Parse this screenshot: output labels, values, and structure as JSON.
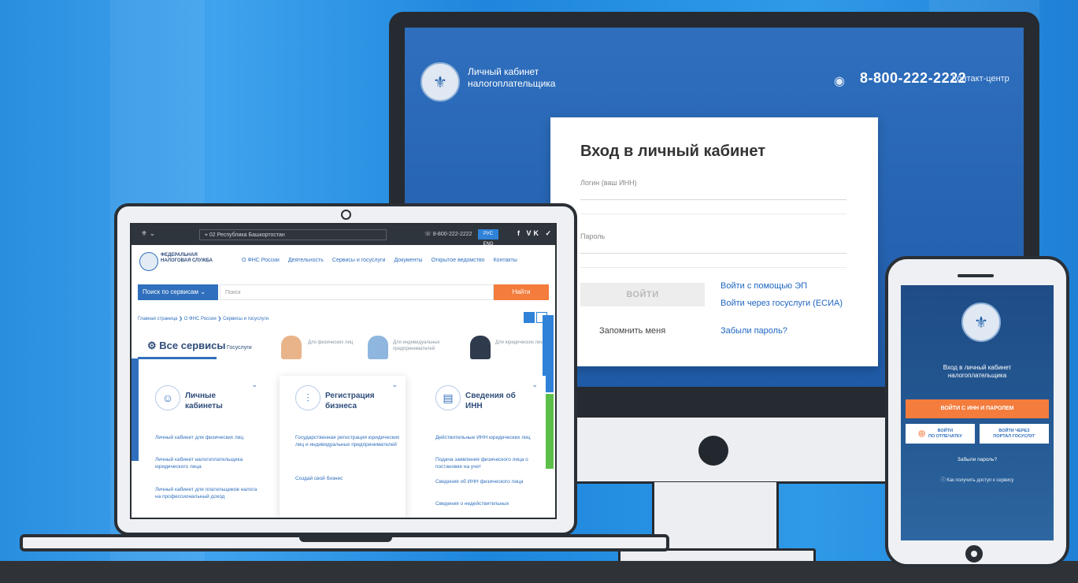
{
  "monitor": {
    "brand_line1": "Личный кабинет",
    "brand_line2": "налогоплательщика",
    "phone": "8-800-222-2222",
    "contact_center": "Контакт-центр",
    "login": {
      "title": "Вход в личный кабинет",
      "login_label": "Логин (ваш ИНН)",
      "password_label": "Пароль",
      "submit": "ВОЙТИ",
      "remember": "Запомнить меня",
      "ep_link": "Войти с помощью ЭП",
      "gos_link": "Войти через госуслуги (ЕСИА)",
      "forgot_link": "Забыли пароль?"
    }
  },
  "laptop": {
    "region": "02 Республика Башкортостан",
    "phone": "8-800-222-2222",
    "lang": "РУС ENG",
    "social": "f  VK  ✓",
    "org_line1": "ФЕДЕРАЛЬНАЯ",
    "org_line2": "НАЛОГОВАЯ СЛУЖБА",
    "nav": [
      "О ФНС России",
      "Деятельность",
      "Сервисы и госуслуги",
      "Документы",
      "Открытое ведомство",
      "Контакты"
    ],
    "search_select": "Поиск по сервисам",
    "search_placeholder": "Поиск",
    "find_button": "Найти",
    "breadcrumb": "Главная страница ❯ О ФНС России ❯ Сервисы и госуслуги",
    "all_services": "Все сервисы",
    "gosuslugi": "Госуслуги",
    "categories": [
      {
        "label": "Для физических лиц"
      },
      {
        "label": "Для индивидуальных предпринимателей"
      },
      {
        "label": "Для юридических лиц"
      }
    ],
    "side_tab": "ВАШ КОНТРОЛЬ",
    "columns": [
      {
        "title_line1": "Личные",
        "title_line2": "кабинеты",
        "items": [
          "Личный кабинет для физических лиц",
          "Личный кабинет налогоплательщика юридического лица",
          "Личный кабинет для плательщиков налога на профессиональный доход"
        ]
      },
      {
        "title_line1": "Регистрация",
        "title_line2": "бизнеса",
        "items": [
          "Государственная регистрация юридических лиц и индивидуальных предпринимателей",
          "Создай свой бизнес"
        ]
      },
      {
        "title_line1": "Сведения об",
        "title_line2": "ИНН",
        "items": [
          "Действительные ИНН юридических лиц",
          "Подача заявления физического лица о постановке на учет",
          "Сведения об ИНН физического лица",
          "Сведения о недействительных"
        ]
      }
    ]
  },
  "phone": {
    "title_line1": "Вход в личный кабинет",
    "title_line2": "налогоплательщика",
    "inn_button": "ВОЙТИ С ИНН И ПАРОЛЕМ",
    "finger_button_line1": "ВОЙТИ",
    "finger_button_line2": "ПО ОТПЕЧАТКУ",
    "gos_button_line1": "ВОЙТИ ЧЕРЕЗ",
    "gos_button_line2": "ПОРТАЛ ГОСУСЛУГ",
    "forgot": "Забыли пароль?",
    "howto": "Как получить доступ к сервису"
  },
  "colors": {
    "background_blue": "#2a8ee0",
    "accent_orange": "#f47c3c",
    "link_blue": "#1f66c2",
    "device_frame": "#262b31",
    "green_tab": "#5cbf4a"
  },
  "icons": [
    "eye-icon",
    "fns-logo-icon",
    "location-pin-icon",
    "phone-icon",
    "chevron-down-icon",
    "grid-view-icon",
    "list-view-icon",
    "gear-services-icon",
    "person-icon",
    "chart-icon",
    "document-icon",
    "fingerprint-icon",
    "question-icon"
  ]
}
